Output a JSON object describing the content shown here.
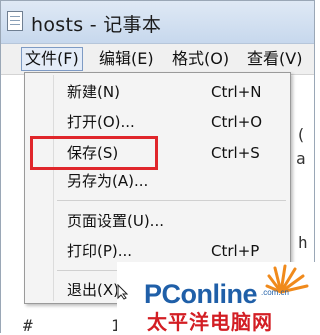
{
  "window": {
    "title": "hosts - 记事本"
  },
  "menubar": {
    "items": [
      {
        "label": "文件(F)"
      },
      {
        "label": "编辑(E)"
      },
      {
        "label": "格式(O)"
      },
      {
        "label": "查看(V)"
      }
    ]
  },
  "file_menu": {
    "items": [
      {
        "label": "新建(N)",
        "shortcut": "Ctrl+N"
      },
      {
        "label": "打开(O)...",
        "shortcut": "Ctrl+O"
      },
      {
        "label": "保存(S)",
        "shortcut": "Ctrl+S"
      },
      {
        "label": "另存为(A)...",
        "shortcut": ""
      },
      {
        "label": "页面设置(U)...",
        "shortcut": ""
      },
      {
        "label": "打印(P)...",
        "shortcut": "Ctrl+P"
      },
      {
        "label": "退出(X)",
        "shortcut": ""
      }
    ]
  },
  "editor": {
    "fragments": [
      "(",
      "a",
      "h",
      "#",
      "1"
    ]
  },
  "watermark": {
    "brand": "PConline",
    "domain": ".com.cn",
    "chinese": "太平洋电脑网"
  },
  "colors": {
    "highlight_border": "#e0262b",
    "brand_blue": "#1f5fa8",
    "brand_red": "#d31e24"
  }
}
